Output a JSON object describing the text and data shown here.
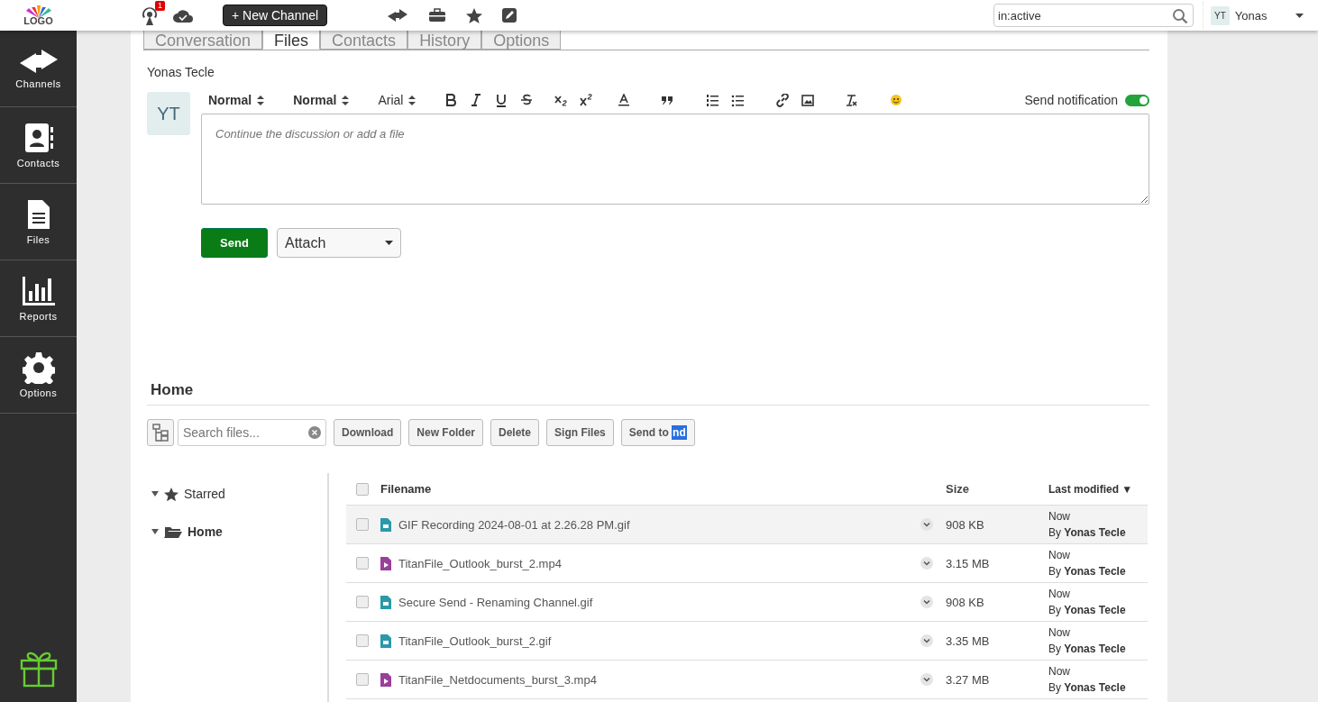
{
  "header": {
    "logo": "LOGO",
    "notification_count": "1",
    "new_channel_button": "+ New Channel",
    "search": {
      "value": "in:active"
    },
    "user": {
      "initials": "YT",
      "name": "Yonas"
    }
  },
  "sidebar": {
    "items": [
      {
        "label": "Channels",
        "kind": "channels"
      },
      {
        "label": "Contacts",
        "kind": "contacts"
      },
      {
        "label": "Files",
        "kind": "files"
      },
      {
        "label": "Reports",
        "kind": "reports"
      },
      {
        "label": "Options",
        "kind": "options"
      }
    ]
  },
  "tabs": [
    {
      "label": "Conversation",
      "selected": false
    },
    {
      "label": "Files",
      "selected": true
    },
    {
      "label": "Contacts",
      "selected": false
    },
    {
      "label": "History",
      "selected": false
    },
    {
      "label": "Options",
      "selected": false
    }
  ],
  "composer": {
    "author": "Yonas Tecle",
    "avatar": "YT",
    "toolbar": {
      "heading": "Normal",
      "size": "Normal",
      "font": "Arial"
    },
    "send_notification": {
      "label": "Send notification",
      "on": true
    },
    "placeholder": "Continue the discussion or add a file",
    "send_button": "Send",
    "attach": "Attach"
  },
  "files": {
    "title": "Home",
    "search_placeholder": "Search files...",
    "actions": [
      "Download",
      "New Folder",
      "Delete",
      "Sign Files"
    ],
    "send_to": {
      "label": "Send to",
      "highlight": "nd"
    },
    "tree": [
      {
        "label": "Starred",
        "kind": "starred",
        "expanded": true,
        "selected": false
      },
      {
        "label": "Home",
        "kind": "folder",
        "expanded": true,
        "selected": true
      }
    ],
    "table": {
      "columns": [
        "Filename",
        "Size",
        "Last modified ▼"
      ],
      "all_checked": false,
      "rows": [
        {
          "name": "GIF Recording 2024-08-01 at 2.26.28 PM.gif",
          "kind": "image",
          "size": "908 KB",
          "when": "Now",
          "by": "By **Yonas Tecle**",
          "selected": true,
          "checked": false
        },
        {
          "name": "TitanFile_Outlook_burst_2.mp4",
          "kind": "video",
          "size": "3.15 MB",
          "when": "Now",
          "by": "By **Yonas Tecle**",
          "selected": false,
          "checked": false
        },
        {
          "name": "Secure Send - Renaming Channel.gif",
          "kind": "image",
          "size": "908 KB",
          "when": "Now",
          "by": "By **Yonas Tecle**",
          "selected": false,
          "checked": false
        },
        {
          "name": "TitanFile_Outlook_burst_2.gif",
          "kind": "image",
          "size": "3.35 MB",
          "when": "Now",
          "by": "By **Yonas Tecle**",
          "selected": false,
          "checked": false
        },
        {
          "name": "TitanFile_Netdocuments_burst_3.mp4",
          "kind": "video",
          "size": "3.27 MB",
          "when": "Now",
          "by": "By **Yonas Tecle**",
          "selected": false,
          "checked": false
        }
      ]
    }
  }
}
